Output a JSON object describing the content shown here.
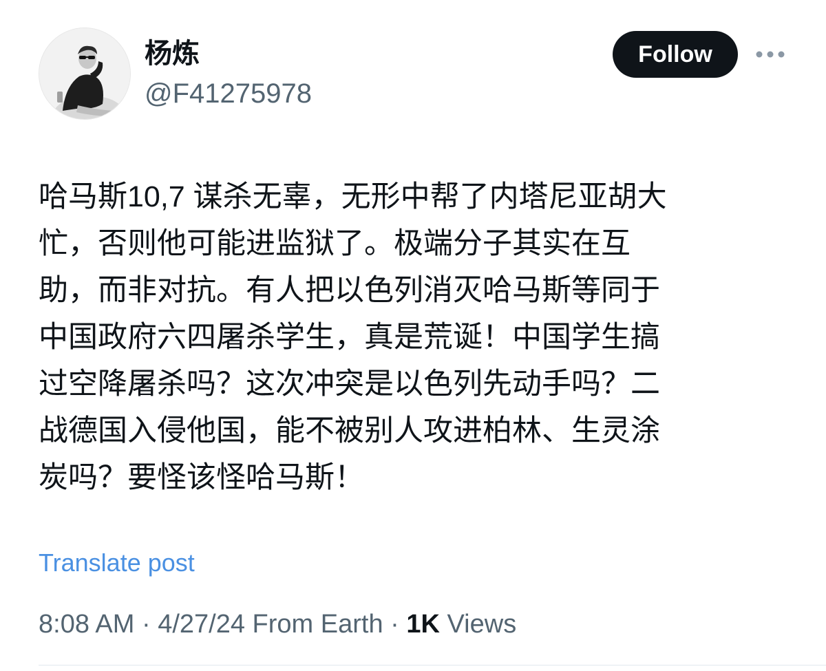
{
  "author": {
    "display_name": "杨炼",
    "handle": "@F41275978",
    "avatar": "avatar-photo"
  },
  "actions": {
    "follow_label": "Follow",
    "more_icon": "more-horizontal-icon"
  },
  "post": {
    "lines": [
      "哈马斯10,7 谋杀无辜，无形中帮了内塔尼亚胡大",
      "忙，否则他可能进监狱了。极端分子其实在互",
      "助，而非对抗。有人把以色列消灭哈马斯等同于",
      "中国政府六四屠杀学生，真是荒诞！中国学生搞",
      "过空降屠杀吗？这次冲突是以色列先动手吗？二",
      "战德国入侵他国，能不被别人攻进柏林、生灵涂",
      "炭吗？要怪该怪哈马斯！"
    ],
    "translate_label": "Translate post"
  },
  "meta": {
    "time": "8:08 AM",
    "separator": " · ",
    "date": "4/27/24",
    "source": " From Earth",
    "views_count": "1K",
    "views_label": " Views"
  },
  "colors": {
    "text": "#0f1419",
    "secondary": "#536471",
    "link": "#4a90e2",
    "button_bg": "#0f1419",
    "button_text": "#ffffff"
  }
}
